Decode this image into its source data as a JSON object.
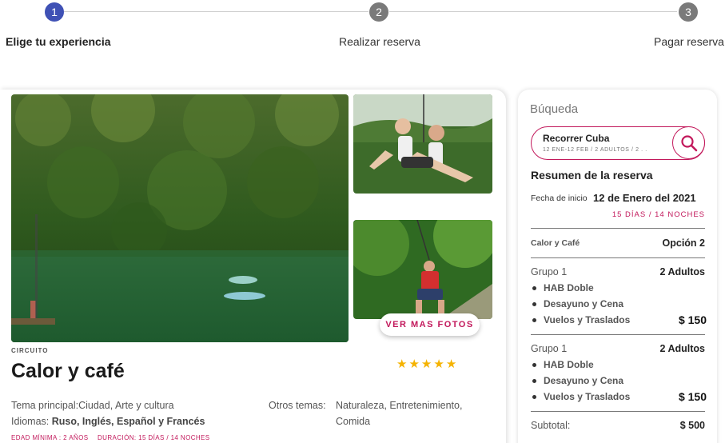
{
  "stepper": {
    "steps": [
      {
        "number": "1",
        "label": "Elige tu experiencia",
        "state": "active"
      },
      {
        "number": "2",
        "label": "Realizar reserva",
        "state": "inactive"
      },
      {
        "number": "3",
        "label": "Pagar reserva",
        "state": "inactive"
      }
    ]
  },
  "tour": {
    "more_photos_label": "VER MAS FOTOS",
    "category": "CIRCUITO",
    "title": "Calor y café",
    "rating_stars": 5,
    "main_theme_label": "Tema principal:",
    "main_theme_value": "Ciudad, Arte y cultura",
    "languages_label": "Idiomas:",
    "languages_value": "Ruso, Inglés, Español y Francés",
    "other_themes_label": "Otros temas:",
    "other_themes_line1": "Naturaleza, Entretenimiento,",
    "other_themes_line2": "Comida",
    "min_age": "EDAD MÍNIMA : 2 AÑOS",
    "duration": "DURACIÓN: 15 DÍAS / 14 NOCHES"
  },
  "sidebar": {
    "title": "Búqueda",
    "search": {
      "value": "Recorrer Cuba",
      "summary": "12 ENE-12 FEB / 2 ADULTOS / 2 . ."
    },
    "summary_title": "Resumen de la reserva",
    "start_label": "Fecha de inicio",
    "start_date": "12 de Enero del 2021",
    "duration": "15 DÍAS / 14 NOCHES",
    "product_name": "Calor y Café",
    "option": "Opción 2",
    "groups": [
      {
        "name": "Grupo 1",
        "pax": "2 Adultos",
        "items": [
          "HAB Doble",
          "Desayuno y Cena",
          "Vuelos y Traslados"
        ],
        "price": "$ 150"
      },
      {
        "name": "Grupo 1",
        "pax": "2 Adultos",
        "items": [
          "HAB Doble",
          "Desayuno y Cena",
          "Vuelos y Traslados"
        ],
        "price": "$ 150"
      }
    ],
    "subtotal_label": "Subtotal:",
    "subtotal_value": "$ 500"
  },
  "colors": {
    "accent": "#c2185b",
    "step_active": "#3f51b5",
    "step_inactive": "#7a7a7a",
    "star": "#f5b301"
  }
}
